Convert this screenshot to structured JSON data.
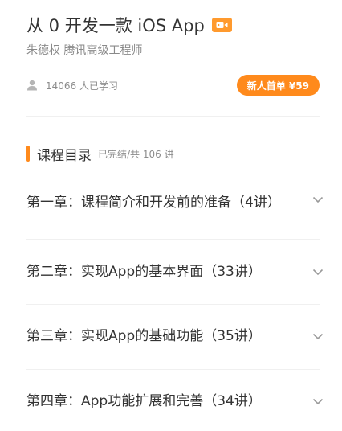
{
  "course": {
    "title": "从 0 开发一款 iOS App",
    "instructor": "朱德权 腾讯高级工程师",
    "learners": "14066 人已学习",
    "price_button": "新人首单 ¥59"
  },
  "catalog": {
    "heading": "课程目录",
    "note": "已完结/共 106 讲",
    "chapters": [
      {
        "title": "第一章：课程简介和开发前的准备（4讲）"
      },
      {
        "title": "第二章：实现App的基本界面（33讲）"
      },
      {
        "title": "第三章：实现App的基础功能（35讲）"
      },
      {
        "title": "第四章：App功能扩展和完善（34讲）"
      }
    ]
  },
  "colors": {
    "accent": "#ff8a1c",
    "video_badge": "#ff9a2e",
    "text_primary": "#333333",
    "text_secondary": "#8c8c8c"
  },
  "icons": {
    "badge": "video-icon",
    "learners": "user-icon",
    "expand": "chevron-down-icon"
  }
}
